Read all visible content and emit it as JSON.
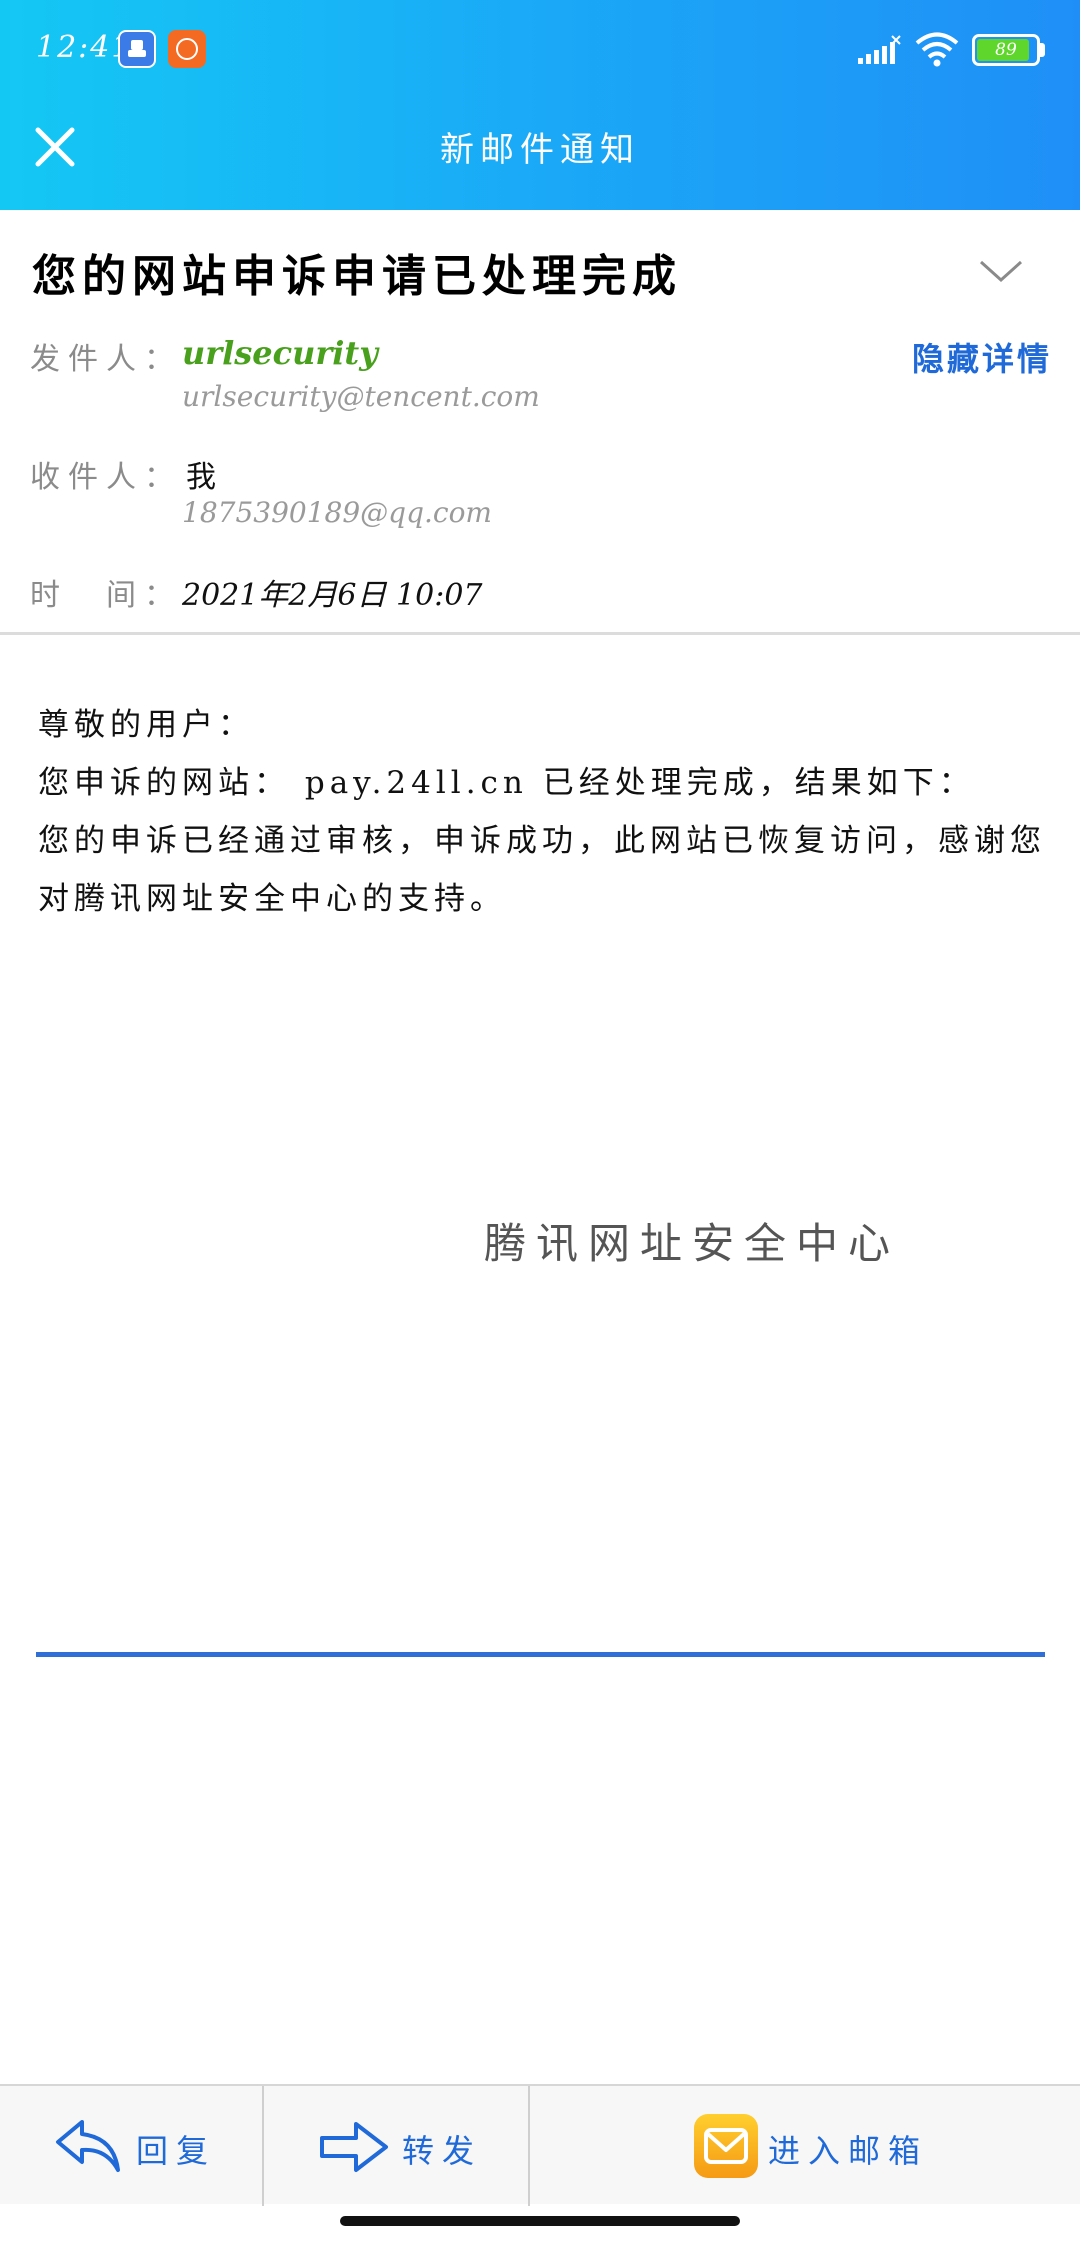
{
  "status_bar": {
    "time": "12:41",
    "battery": "89",
    "battery_level": 0.89,
    "icons": [
      "app-notification-icon",
      "mi-app-icon",
      "signal-icon",
      "wifi-icon",
      "battery-icon"
    ]
  },
  "header": {
    "title": "新邮件通知",
    "close_icon": "close-icon"
  },
  "mail": {
    "subject": "您的网站申诉申请已处理完成",
    "sender_label": "发件人：",
    "sender_name": "urlsecurity",
    "sender_email": "urlsecurity@tencent.com",
    "hide_details": "隐藏详情",
    "recipient_label": "收件人：",
    "recipient_name": "我",
    "recipient_email": "1875390189@qq.com",
    "time_label": "时　间：",
    "time_value": "2021年2月6日 10:07"
  },
  "body": {
    "greeting": "尊敬的用户：",
    "line1": "您申诉的网站： pay.24ll.cn 已经处理完成，结果如下：",
    "line2": "您的申诉已经通过审核，申诉成功，此网站已恢复访问，感谢您对腾讯网址安全中心的支持。",
    "signature": "腾讯网址安全中心"
  },
  "toolbar": {
    "reply": "回复",
    "forward": "转发",
    "open_mailbox": "进入邮箱"
  },
  "colors": {
    "header_start": "#14c8f4",
    "header_end": "#1f8ff7",
    "sender_green": "#49a01d",
    "link_blue": "#1f6ad8",
    "divider_blue": "#2f6fd6"
  }
}
